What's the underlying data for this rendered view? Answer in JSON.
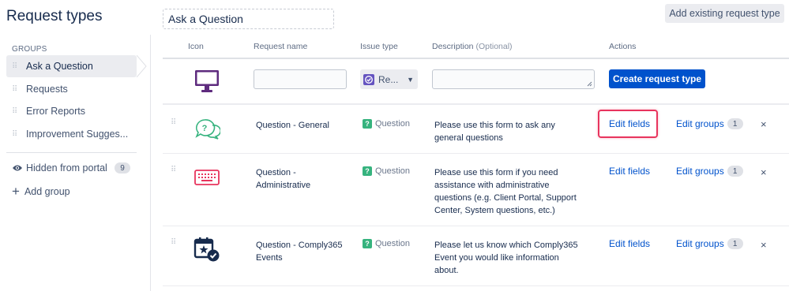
{
  "page": {
    "title": "Request types"
  },
  "toolbar": {
    "title_input_value": "Ask a Question",
    "add_existing_label": "Add existing request type"
  },
  "sidebar": {
    "groups_heading": "GROUPS",
    "items": [
      {
        "label": "Ask a Question",
        "active": true
      },
      {
        "label": "Requests",
        "active": false
      },
      {
        "label": "Error Reports",
        "active": false
      },
      {
        "label": "Improvement Sugges...",
        "active": false
      }
    ],
    "hidden": {
      "label": "Hidden from portal",
      "count": "9"
    },
    "add_group_label": "Add group"
  },
  "table": {
    "headers": {
      "icon": "Icon",
      "request_name": "Request name",
      "issue_type": "Issue type",
      "description": "Description",
      "description_optional": "(Optional)",
      "actions": "Actions"
    },
    "create_row": {
      "issue_type_value": "Re...",
      "create_button_label": "Create request type"
    },
    "rows": [
      {
        "name": "Question - General",
        "icon": "chat-question-icon",
        "issue_type": "Question",
        "description": "Please use this form to ask any general questions",
        "edit_fields": "Edit fields",
        "edit_groups": "Edit groups",
        "groups_count": "1"
      },
      {
        "name": "Question - Administrative",
        "icon": "keyboard-icon",
        "issue_type": "Question",
        "description": "Please use this form if you need assistance with administrative questions (e.g. Client Portal, Support Center, System questions, etc.)",
        "edit_fields": "Edit fields",
        "edit_groups": "Edit groups",
        "groups_count": "1"
      },
      {
        "name": "Question - Comply365 Events",
        "icon": "calendar-check-icon",
        "issue_type": "Question",
        "description": "Please let us know which Comply365 Event you would like information about.",
        "edit_fields": "Edit fields",
        "edit_groups": "Edit groups",
        "groups_count": "1"
      }
    ]
  },
  "icons": {
    "question_issue": "?",
    "close": "×",
    "drag": "⠿"
  },
  "colors": {
    "primary": "#0052cc",
    "highlight": "#e8345d",
    "question_green": "#36b37e"
  }
}
